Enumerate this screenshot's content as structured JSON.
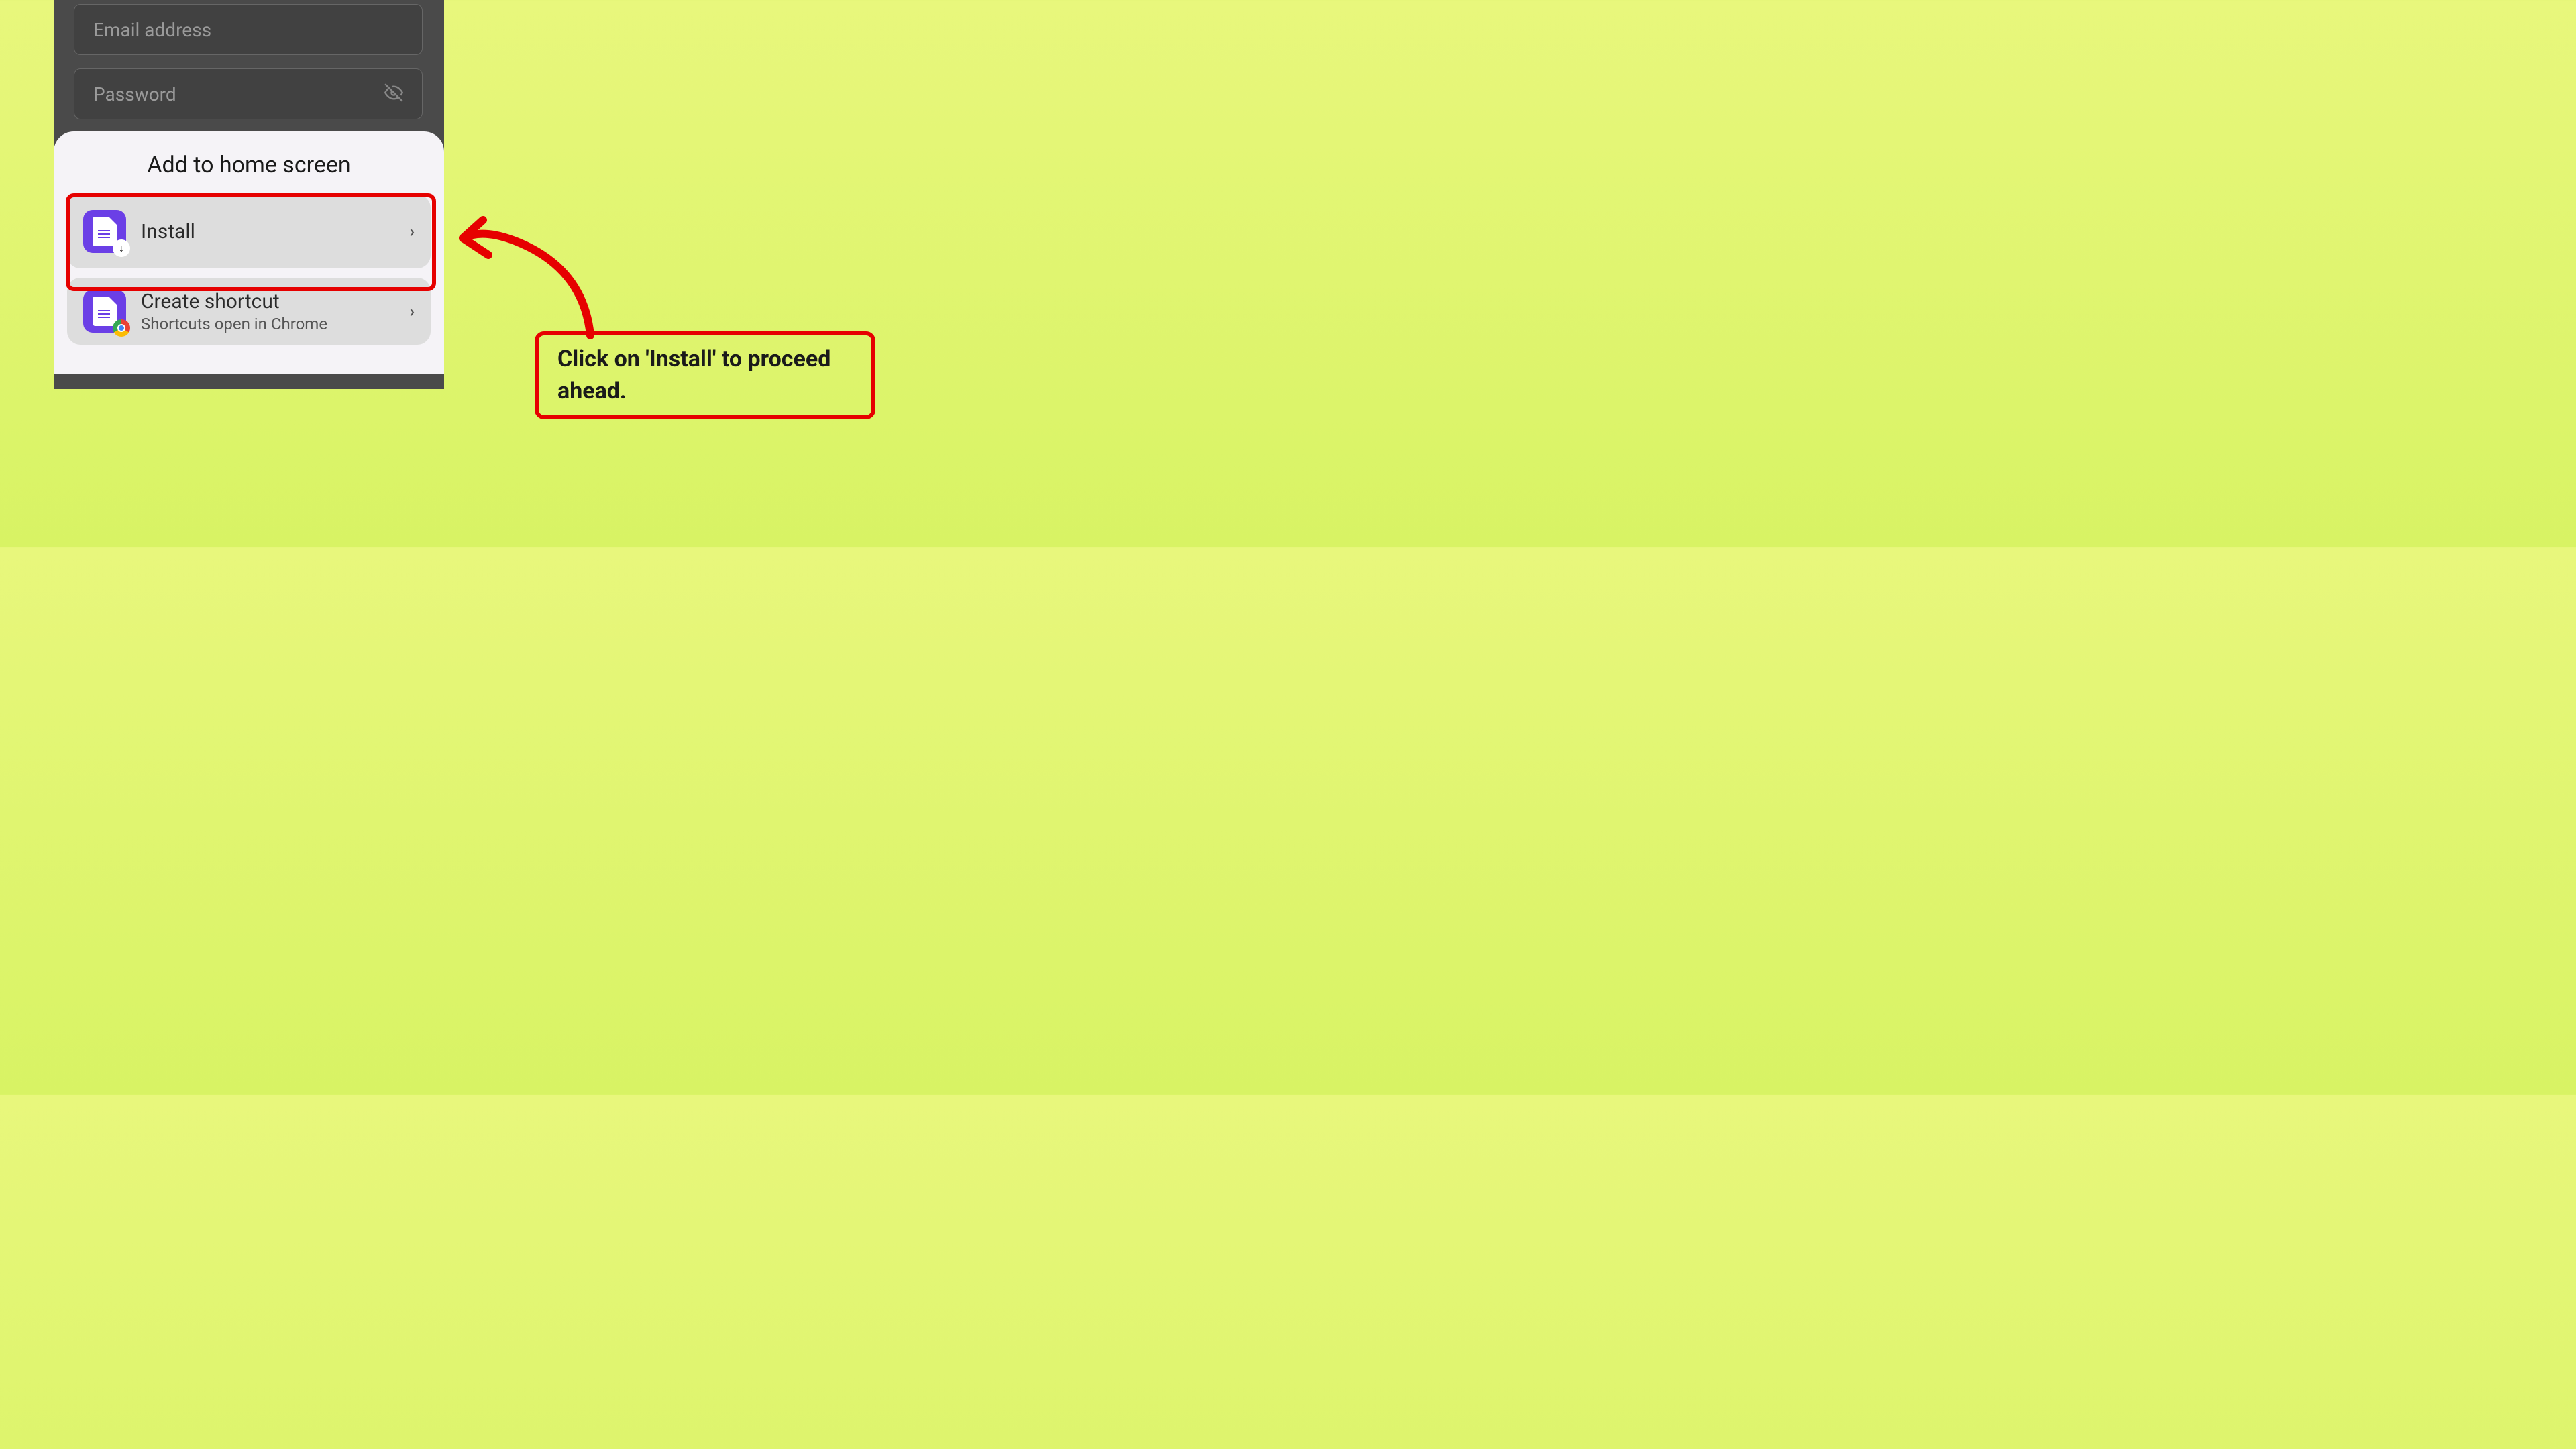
{
  "background_form": {
    "email_placeholder": "Email address",
    "password_placeholder": "Password"
  },
  "sheet": {
    "title": "Add to home screen",
    "options": [
      {
        "label": "Install",
        "subtitle": ""
      },
      {
        "label": "Create shortcut",
        "subtitle": "Shortcuts open in Chrome"
      }
    ]
  },
  "callout": {
    "text": "Click on 'Install' to proceed ahead."
  },
  "colors": {
    "highlight_red": "#e60000",
    "app_purple": "#6b3fe6"
  }
}
